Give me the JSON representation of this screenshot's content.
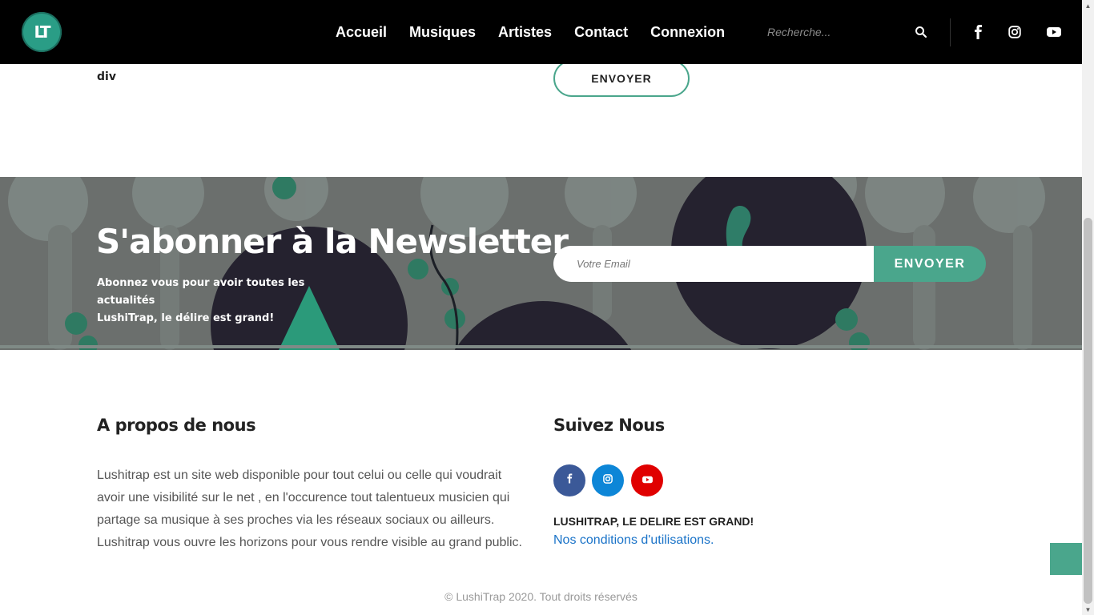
{
  "header": {
    "logo_text": "LT",
    "nav": [
      "Accueil",
      "Musiques",
      "Artistes",
      "Contact",
      "Connexion"
    ],
    "search_placeholder": "Recherche...",
    "icons": [
      "search-icon",
      "facebook-icon",
      "instagram-icon",
      "youtube-icon"
    ]
  },
  "contact_section": {
    "leftover_text": "div",
    "send_label": "ENVOYER"
  },
  "newsletter": {
    "title": "S'abonner à la Newsletter",
    "description_line1": "Abonnez vous pour avoir toutes les actualités",
    "description_line2": "LushiTrap, le délire est grand!",
    "email_placeholder": "Votre Email",
    "send_label": "ENVOYER"
  },
  "footer": {
    "about_title": "A propos de nous",
    "about_text": "Lushitrap est un site web disponible pour tout celui ou celle qui voudrait avoir une visibilité sur le net , en l'occurence tout talentueux musicien qui partage sa musique à ses proches via les réseaux sociaux ou ailleurs. Lushitrap vous ouvre les horizons pour vous rendre visible au grand public.",
    "follow_title": "Suivez Nous",
    "social": [
      {
        "name": "facebook",
        "color": "#3b5998"
      },
      {
        "name": "instagram",
        "color": "#0d86d7"
      },
      {
        "name": "youtube",
        "color": "#e00000"
      }
    ],
    "slogan": "LUSHITRAP, LE DELIRE EST GRAND!",
    "terms_link": "Nos conditions d'utilisations.",
    "copyright": "© LushiTrap 2020. Tout droits réservés"
  },
  "colors": {
    "accent": "#4aa68c",
    "header_bg": "#000000",
    "link": "#1a73c8"
  }
}
